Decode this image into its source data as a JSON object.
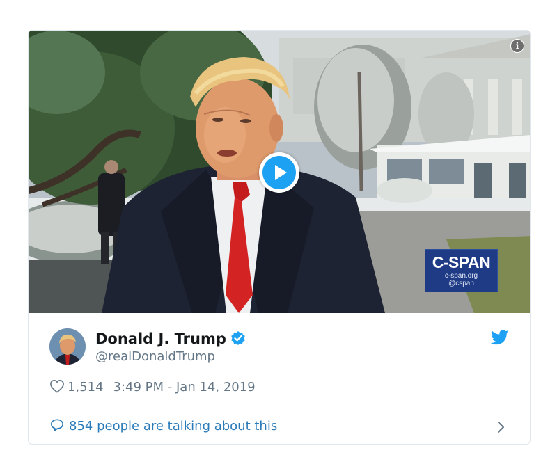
{
  "media": {
    "info_icon": "info-icon",
    "play_icon": "play-icon",
    "cspan": {
      "logo": "C-SPAN",
      "site": "c-span.org",
      "handle": "@cspan"
    }
  },
  "author": {
    "name": "Donald J. Trump",
    "handle": "@realDonaldTrump",
    "verified": true,
    "avatar_icon": "avatar",
    "verified_icon": "verified-badge-icon"
  },
  "meta": {
    "likes": "1,514",
    "timestamp": "3:49 PM - Jan 14, 2019",
    "heart_icon": "heart-icon"
  },
  "footer": {
    "talking": "854 people are talking about this",
    "bubble_icon": "speech-bubble-icon",
    "chevron_icon": "chevron-right-icon"
  },
  "colors": {
    "twitter_blue": "#1da1f2",
    "link_blue": "#2b7bb9",
    "tie_red": "#d42323",
    "cspan_blue": "#1f3b86",
    "text_dark": "#14171a",
    "text_gray": "#657786"
  }
}
